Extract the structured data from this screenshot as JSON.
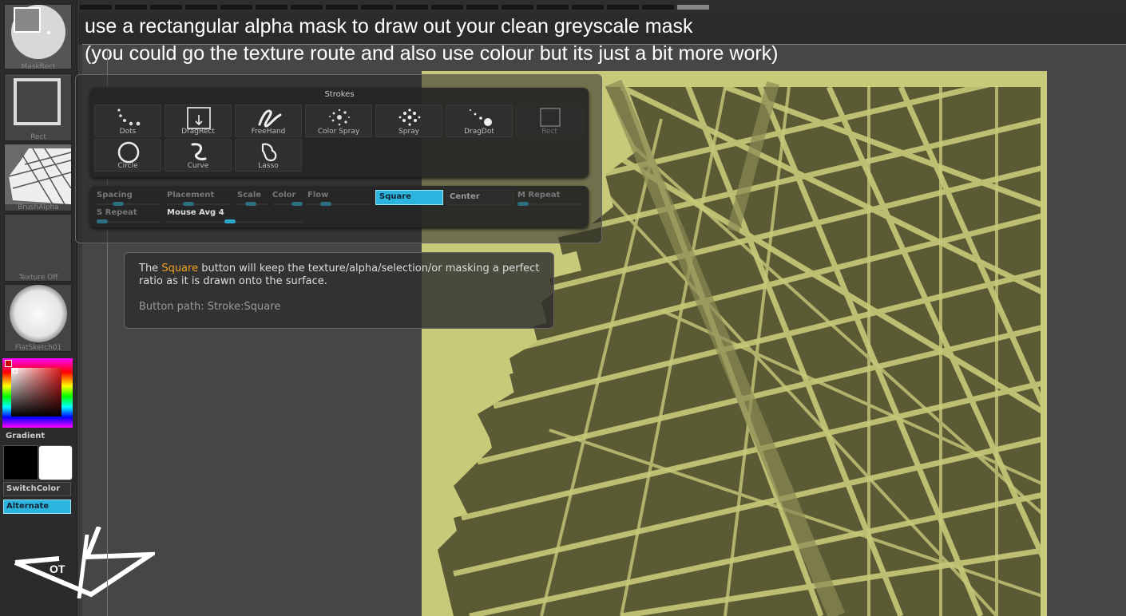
{
  "caption": {
    "line1": "use a rectangular alpha mask to draw out your clean greyscale mask",
    "line2": "(you could go the texture route and also use colour but its just a bit more work)"
  },
  "shelf": {
    "slots": [
      {
        "label": "MaskRect",
        "icon": "maskrect-icon"
      },
      {
        "label": "Rect",
        "icon": "rect-icon"
      },
      {
        "label": "BrushAlpha",
        "icon": "brush-alpha-map-icon"
      },
      {
        "label": "Texture Off",
        "icon": "texture-off-icon"
      },
      {
        "label": "FlatSketch01",
        "icon": "sphere-material-icon"
      }
    ],
    "gradient_label": "Gradient",
    "switch_color": "SwitchColor",
    "alternate": "Alternate"
  },
  "strokes": {
    "title": "Strokes",
    "buttons": [
      {
        "label": "Dots",
        "icon": "dots-icon"
      },
      {
        "label": "DragRect",
        "icon": "dragrect-icon"
      },
      {
        "label": "FreeHand",
        "icon": "freehand-icon"
      },
      {
        "label": "Color Spray",
        "icon": "color-spray-icon"
      },
      {
        "label": "Spray",
        "icon": "spray-icon"
      },
      {
        "label": "DragDot",
        "icon": "dragdot-icon"
      },
      {
        "label": "Rect",
        "icon": "rect-stroke-icon",
        "disabled": true
      },
      {
        "label": "Circle",
        "icon": "circle-icon"
      },
      {
        "label": "Curve",
        "icon": "curve-icon"
      },
      {
        "label": "Lasso",
        "icon": "lasso-icon"
      }
    ]
  },
  "settings": {
    "spacing": "Spacing",
    "placement": "Placement",
    "scale": "Scale",
    "color": "Color",
    "flow": "Flow",
    "square": "Square",
    "center": "Center",
    "m_repeat": "M Repeat",
    "s_repeat": "S Repeat",
    "mouse_avg": "Mouse Avg 4"
  },
  "tooltip": {
    "text_before": "The ",
    "highlight": "Square",
    "text_after": " button will keep the texture/alpha/selection/or masking a perfect ratio as it is drawn onto the surface.",
    "path": "Button path: Stroke:Square"
  },
  "colors": {
    "map_light": "#c9c97a",
    "map_dark": "#5a5a34",
    "accent": "#2bb4de",
    "highlight": "#f0a020"
  }
}
